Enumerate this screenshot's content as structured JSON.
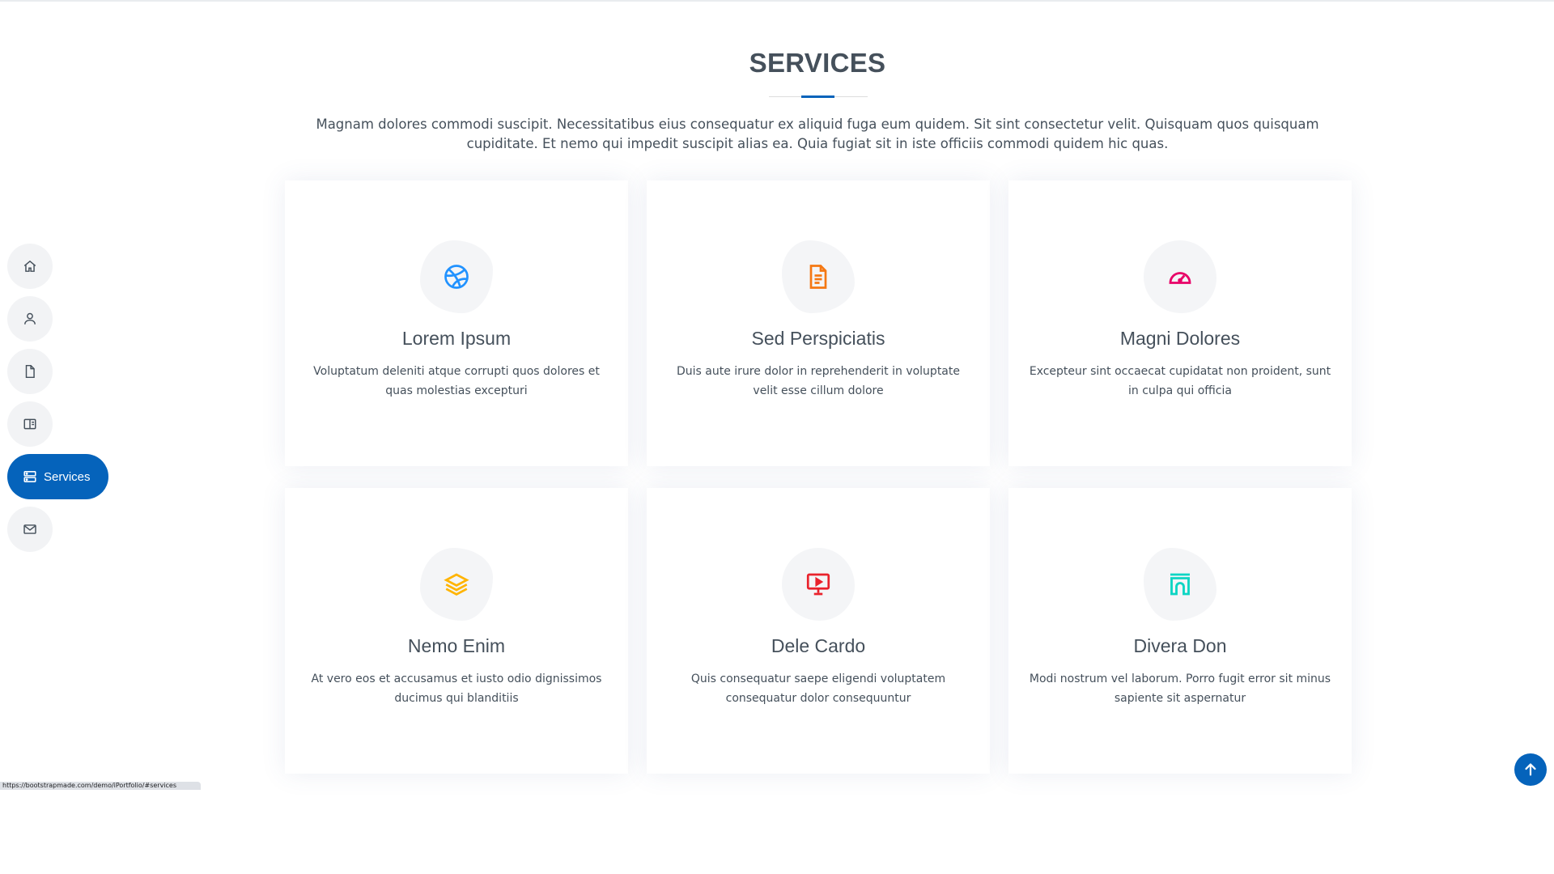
{
  "nav": {
    "items": [
      {
        "id": "home",
        "icon": "house-icon",
        "label": ""
      },
      {
        "id": "about",
        "icon": "person-icon",
        "label": ""
      },
      {
        "id": "resume",
        "icon": "file-icon",
        "label": ""
      },
      {
        "id": "portfolio",
        "icon": "book-half-icon",
        "label": ""
      },
      {
        "id": "services",
        "icon": "server-icon",
        "label": "Services",
        "active": true
      },
      {
        "id": "contact",
        "icon": "envelope-icon",
        "label": ""
      }
    ]
  },
  "section": {
    "title": "SERVICES",
    "description": "Magnam dolores commodi suscipit. Necessitatibus eius consequatur ex aliquid fuga eum quidem. Sit sint consectetur velit. Quisquam quos quisquam cupiditate. Et nemo qui impedit suscipit alias ea. Quia fugiat sit in iste officiis commodi quidem hic quas."
  },
  "services": [
    {
      "title": "Lorem Ipsum",
      "text": "Voluptatum deleniti atque corrupti quos dolores et quas molestias excepturi",
      "icon": "dribbble-icon",
      "color": "#2192ff"
    },
    {
      "title": "Sed Perspiciatis",
      "text": "Duis aute irure dolor in reprehenderit in voluptate velit esse cillum dolore",
      "icon": "file-text-icon",
      "color": "#f57813"
    },
    {
      "title": "Magni Dolores",
      "text": "Excepteur sint occaecat cupidatat non proident, sunt in culpa qui officia",
      "icon": "speedometer-icon",
      "color": "#e80368"
    },
    {
      "title": "Nemo Enim",
      "text": "At vero eos et accusamus et iusto odio dignissimos ducimus qui blanditiis",
      "icon": "layers-icon",
      "color": "#ffb400"
    },
    {
      "title": "Dele Cardo",
      "text": "Quis consequatur saepe eligendi voluptatem consequatur dolor consequuntur",
      "icon": "easel-icon",
      "color": "#e9222c"
    },
    {
      "title": "Divera Don",
      "text": "Modi nostrum vel laborum. Porro fugit error sit minus sapiente sit aspernatur",
      "icon": "archway-icon",
      "color": "#0dd5c3"
    }
  ],
  "status_bar": {
    "text": "https://bootstrapmade.com/demo/iPortfolio/#services"
  },
  "back_to_top": {
    "icon": "arrow-up-icon"
  },
  "colors": {
    "accent": "#0563bb",
    "heading": "#45505b",
    "nav_bg": "#f2f3f5"
  }
}
